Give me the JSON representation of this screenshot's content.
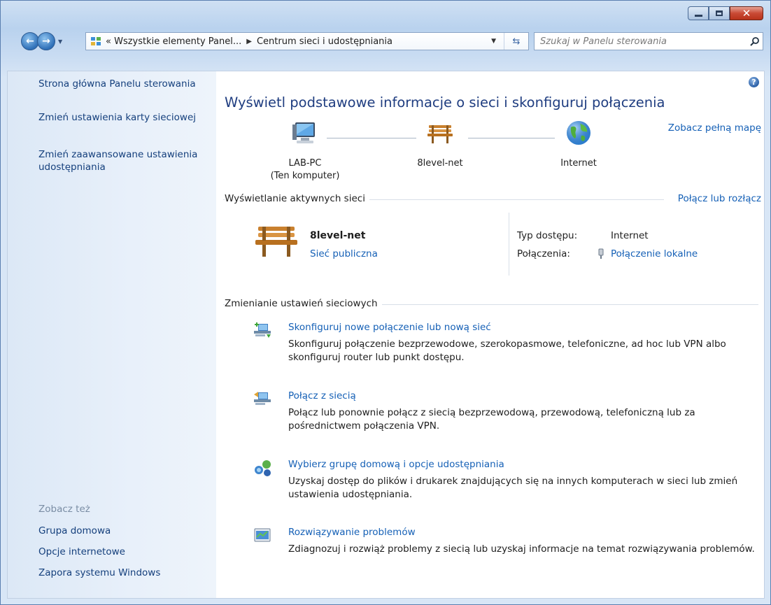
{
  "window": {
    "caption": {
      "minimize": "Minimalizuj",
      "maximize": "Maksymalizuj",
      "close": "Zamknij"
    }
  },
  "address": {
    "crumb1": "« Wszystkie elementy Panel...",
    "crumb2": "Centrum sieci i udostępniania"
  },
  "search": {
    "placeholder": "Szukaj w Panelu sterowania"
  },
  "sidebar": {
    "links": [
      "Strona główna Panelu sterowania",
      "Zmień ustawienia karty sieciowej",
      "Zmień zaawansowane ustawienia udostępniania"
    ],
    "see_also_caption": "Zobacz też",
    "see_also": [
      "Grupa domowa",
      "Opcje internetowe",
      "Zapora systemu Windows"
    ]
  },
  "main": {
    "heading": "Wyświetl podstawowe informacje o sieci i skonfiguruj połączenia",
    "full_map_link": "Zobacz pełną mapę",
    "map": {
      "computer": "LAB-PC",
      "computer_sub": "(Ten komputer)",
      "network": "8level-net",
      "internet": "Internet"
    },
    "active_section": "Wyświetlanie aktywnych sieci",
    "connect_link": "Połącz lub rozłącz",
    "active": {
      "name": "8level-net",
      "type_link": "Sieć publiczna",
      "access_label": "Typ dostępu:",
      "access_value": "Internet",
      "connections_label": "Połączenia:",
      "connections_link": "Połączenie lokalne"
    },
    "change_section": "Zmienianie ustawień sieciowych",
    "tasks": [
      {
        "title": "Skonfiguruj nowe połączenie lub nową sieć",
        "desc": "Skonfiguruj połączenie bezprzewodowe, szerokopasmowe, telefoniczne, ad hoc lub VPN albo skonfiguruj router lub punkt dostępu."
      },
      {
        "title": "Połącz z siecią",
        "desc": "Połącz lub ponownie połącz z siecią bezprzewodową, przewodową, telefoniczną lub za pośrednictwem połączenia VPN."
      },
      {
        "title": "Wybierz grupę domową i opcje udostępniania",
        "desc": "Uzyskaj dostęp do plików i drukarek znajdujących się na innych komputerach w sieci lub zmień ustawienia udostępniania."
      },
      {
        "title": "Rozwiązywanie problemów",
        "desc": "Zdiagnozuj i rozwiąż problemy z siecią lub uzyskaj informacje na temat rozwiązywania problemów."
      }
    ]
  },
  "icons": {
    "back": "back-arrow-icon",
    "forward": "forward-arrow-icon",
    "control_panel": "control-panel-icon",
    "refresh": "refresh-icon",
    "search": "search-icon",
    "help": "help-icon",
    "computer": "computer-icon",
    "bench": "public-network-bench-icon",
    "globe": "internet-globe-icon",
    "nic": "network-adapter-icon"
  },
  "colors": {
    "link": "#1560b6",
    "heading": "#1f3d80",
    "sidebar_link": "#143f7c"
  }
}
